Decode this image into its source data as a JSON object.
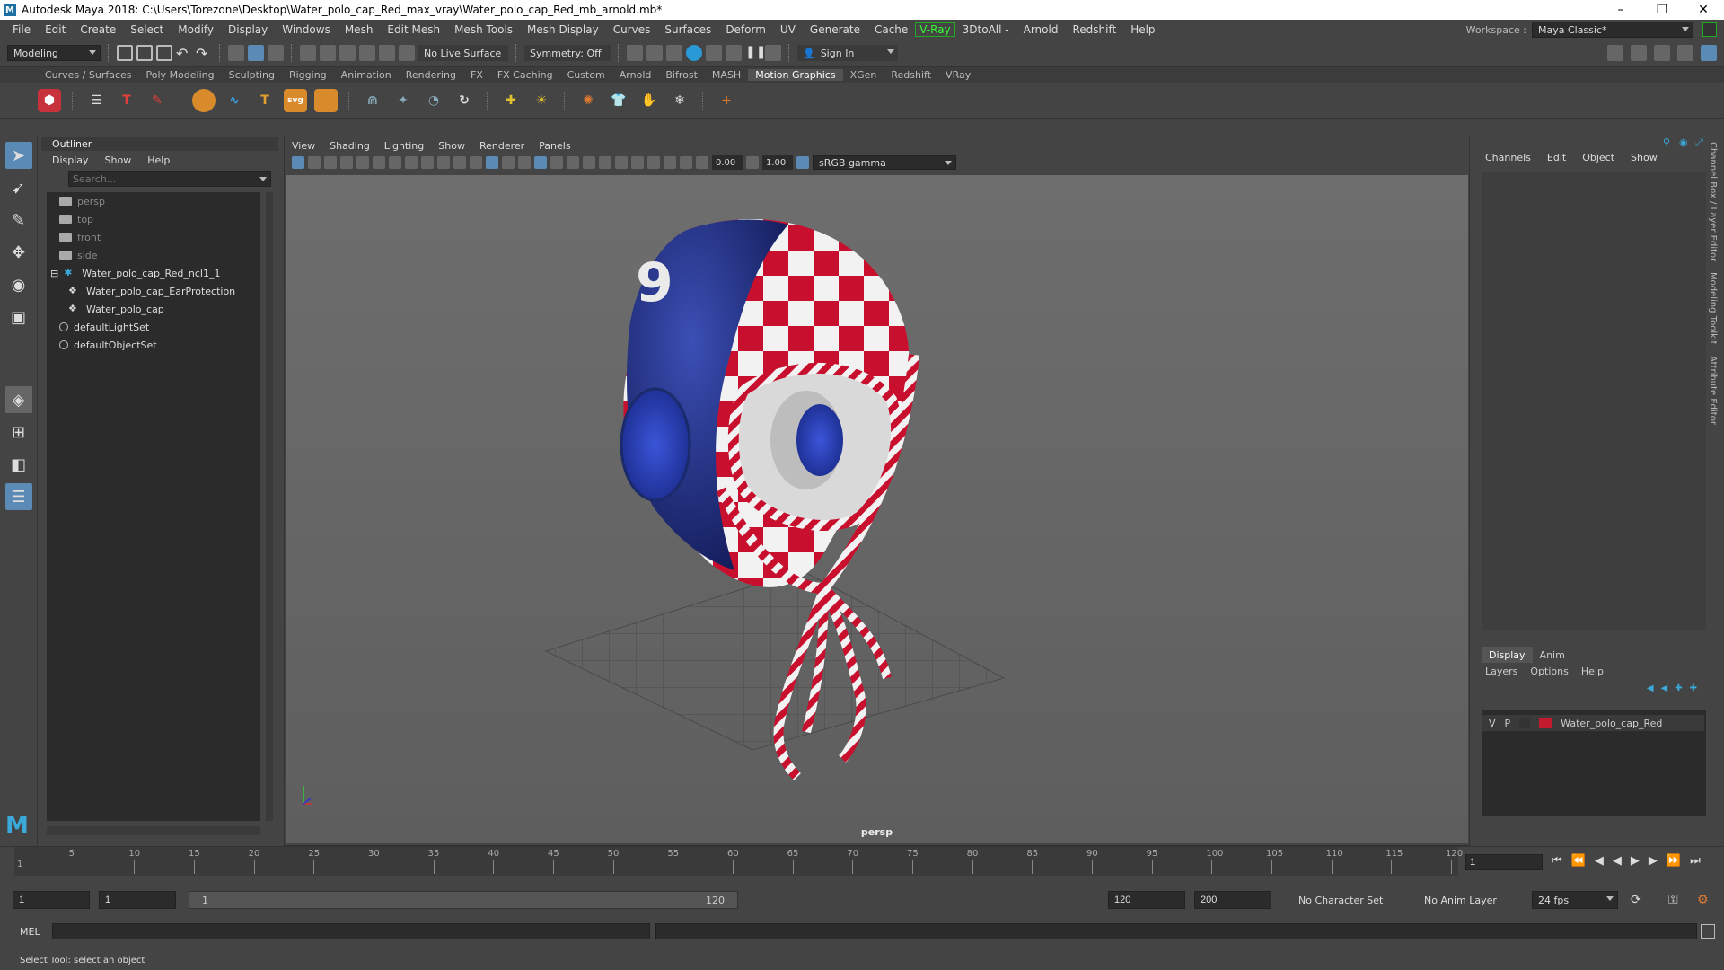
{
  "window": {
    "title": "Autodesk Maya 2018: C:\\Users\\Torezone\\Desktop\\Water_polo_cap_Red_max_vray\\Water_polo_cap_Red_mb_arnold.mb*",
    "minimize": "–",
    "maximize": "❐",
    "close": "✕"
  },
  "menubar": {
    "items": [
      "File",
      "Edit",
      "Create",
      "Select",
      "Modify",
      "Display",
      "Windows",
      "Mesh",
      "Edit Mesh",
      "Mesh Tools",
      "Mesh Display",
      "Curves",
      "Surfaces",
      "Deform",
      "UV",
      "Generate",
      "Cache"
    ],
    "vray": "V-Ray",
    "items2": [
      "3DtoAll -",
      "Arnold",
      "Redshift",
      "Help"
    ],
    "workspace_label": "Workspace :",
    "workspace_value": "Maya Classic*"
  },
  "statusline": {
    "mode": "Modeling",
    "live_surface": "No Live Surface",
    "symmetry": "Symmetry: Off",
    "sign_in": "Sign In"
  },
  "shelf_tabs": [
    "Curves / Surfaces",
    "Poly Modeling",
    "Sculpting",
    "Rigging",
    "Animation",
    "Rendering",
    "FX",
    "FX Caching",
    "Custom",
    "Arnold",
    "Bifrost",
    "MASH",
    "Motion Graphics",
    "XGen",
    "Redshift",
    "VRay"
  ],
  "shelf_active": "Motion Graphics",
  "outliner": {
    "title": "Outliner",
    "menu": [
      "Display",
      "Show",
      "Help"
    ],
    "search_placeholder": "Search...",
    "items": [
      {
        "label": "persp",
        "indent": 1,
        "dim": true,
        "icon": "camera-icon"
      },
      {
        "label": "top",
        "indent": 1,
        "dim": true,
        "icon": "camera-icon"
      },
      {
        "label": "front",
        "indent": 1,
        "dim": true,
        "icon": "camera-icon"
      },
      {
        "label": "side",
        "indent": 1,
        "dim": true,
        "icon": "camera-icon"
      },
      {
        "label": "Water_polo_cap_Red_ncl1_1",
        "indent": 0,
        "dim": false,
        "icon": "group-icon",
        "expand": "⊟"
      },
      {
        "label": "Water_polo_cap_EarProtection",
        "indent": 2,
        "dim": false,
        "icon": "mesh-icon"
      },
      {
        "label": "Water_polo_cap",
        "indent": 2,
        "dim": false,
        "icon": "mesh-icon"
      },
      {
        "label": "defaultLightSet",
        "indent": 1,
        "dim": false,
        "icon": "set-icon"
      },
      {
        "label": "defaultObjectSet",
        "indent": 1,
        "dim": false,
        "icon": "set-icon"
      }
    ]
  },
  "viewport": {
    "menu": [
      "View",
      "Shading",
      "Lighting",
      "Show",
      "Renderer",
      "Panels"
    ],
    "exposure": "0.00",
    "gamma": "1.00",
    "color_space": "sRGB gamma",
    "camera": "persp"
  },
  "channelbox": {
    "menu": [
      "Channels",
      "Edit",
      "Object",
      "Show"
    ],
    "vtabs": [
      "Channel Box / Layer Editor",
      "Modeling Toolkit",
      "Attribute Editor"
    ]
  },
  "layer_editor": {
    "tabs": [
      "Display",
      "Anim"
    ],
    "menu": [
      "Layers",
      "Options",
      "Help"
    ],
    "layer": {
      "v": "V",
      "p": "P",
      "name": "Water_polo_cap_Red"
    }
  },
  "timeslider": {
    "ticks": [
      "5",
      "10",
      "15",
      "20",
      "25",
      "30",
      "35",
      "40",
      "45",
      "50",
      "55",
      "60",
      "65",
      "70",
      "75",
      "80",
      "85",
      "90",
      "95",
      "100",
      "105",
      "110",
      "115",
      "120"
    ],
    "start_mark": "1",
    "current_frame": "1"
  },
  "range": {
    "start": "1",
    "playback_start": "1",
    "slider_start": "1",
    "slider_end": "120",
    "playback_end": "120",
    "end": "200",
    "character_set": "No Character Set",
    "anim_layer": "No Anim Layer",
    "fps": "24 fps"
  },
  "cmdline": {
    "label": "MEL"
  },
  "helpline": {
    "text": "Select Tool: select an object"
  },
  "colors": {
    "accent": "#5a8ab5",
    "cap_blue": "#1e2d7a",
    "cap_red": "#c8102e",
    "layer_red": "#c21a2e"
  }
}
